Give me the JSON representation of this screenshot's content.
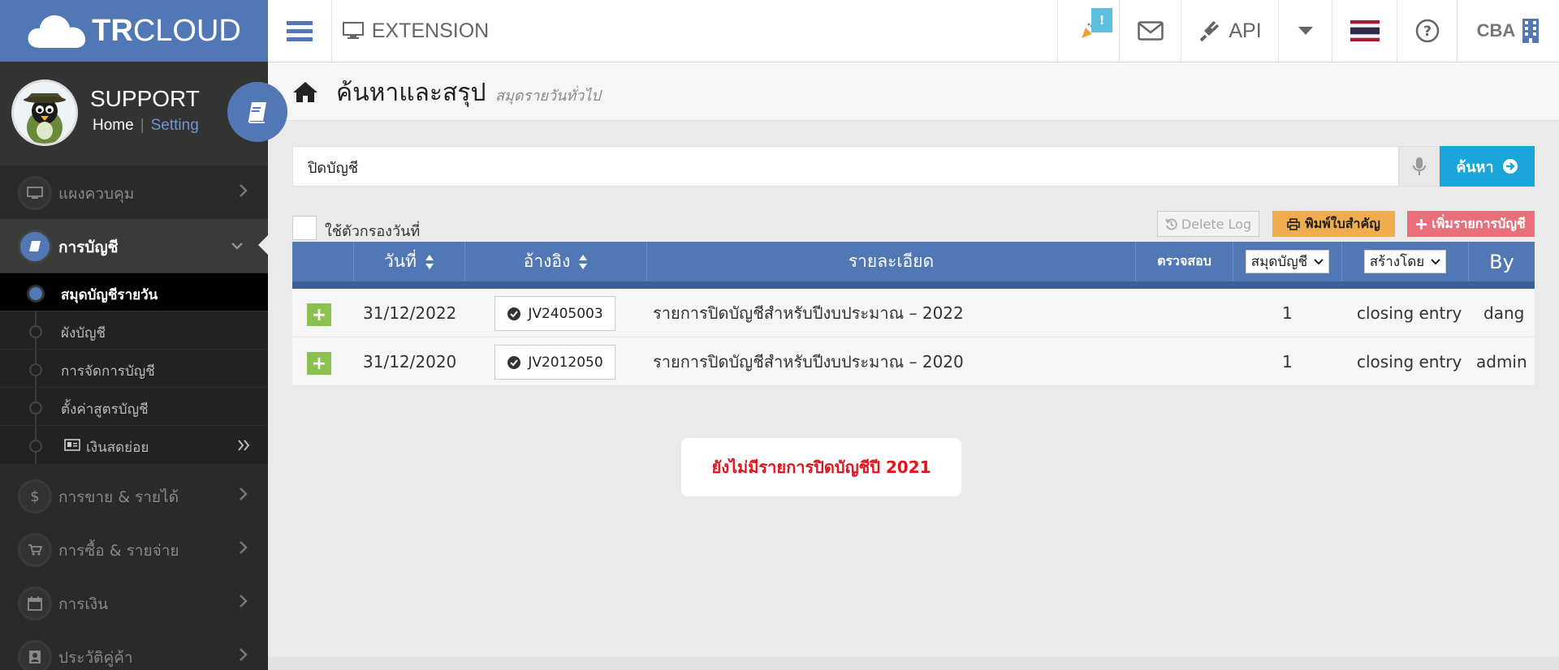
{
  "brand": {
    "logo_text_bold": "TR",
    "logo_text": "CLOUD"
  },
  "topbar": {
    "extension_label": "EXTENSION",
    "notification_badge": "!",
    "api_label": "API",
    "company": "CBA"
  },
  "profile": {
    "name": "SUPPORT",
    "home_link": "Home",
    "separator": "|",
    "setting_link": "Setting"
  },
  "sidebar": {
    "dashboard": "แผงควบคุม",
    "accounting": "การบัญชี",
    "sub_items": [
      "สมุดบัญชีรายวัน",
      "ผังบัญชี",
      "การจัดการบัญชี",
      "ตั้งค่าสูตรบัญชี",
      "เงินสดย่อย"
    ],
    "sales": "การขาย & รายได้",
    "purchases": "การซื้อ & รายจ่าย",
    "finance": "การเงิน",
    "customer_history": "ประวัติคู่ค้า"
  },
  "page": {
    "title": "ค้นหาและสรุป",
    "subtitle": "สมุดรายวันทั่วไป"
  },
  "search": {
    "value": "ปิดบัญชี",
    "button_label": "ค้นหา"
  },
  "filter": {
    "date_filter_label": "ใช้ตัวกรองวันที่"
  },
  "actions": {
    "delete_log": "Delete Log",
    "print": "พิมพ์ใบสำคัญ",
    "add": "เพิ่มรายการบัญชี"
  },
  "table": {
    "headers": {
      "date": "วันที่",
      "reference": "อ้างอิง",
      "detail": "รายละเอียด",
      "audit": "ตรวจสอบ",
      "journal": "สมุดบัญชี",
      "created_by": "สร้างโดย",
      "by": "By"
    },
    "rows": [
      {
        "date": "31/12/2022",
        "ref": "JV2405003",
        "detail": "รายการปิดบัญชีสำหรับปีงบประมาณ – 2022",
        "journal": "1",
        "created_by": "closing entry",
        "by": "dang"
      },
      {
        "date": "31/12/2020",
        "ref": "JV2012050",
        "detail": "รายการปิดบัญชีสำหรับปีงบประมาณ – 2020",
        "journal": "1",
        "created_by": "closing entry",
        "by": "admin"
      }
    ]
  },
  "notice": "ยังไม่มีรายการปิดบัญชีปี 2021",
  "colors": {
    "brand": "#5277b5",
    "search_button": "#1aa6db",
    "print_button": "#f0ad4e",
    "add_button": "#e9707b",
    "notice_text": "#e0141f"
  }
}
